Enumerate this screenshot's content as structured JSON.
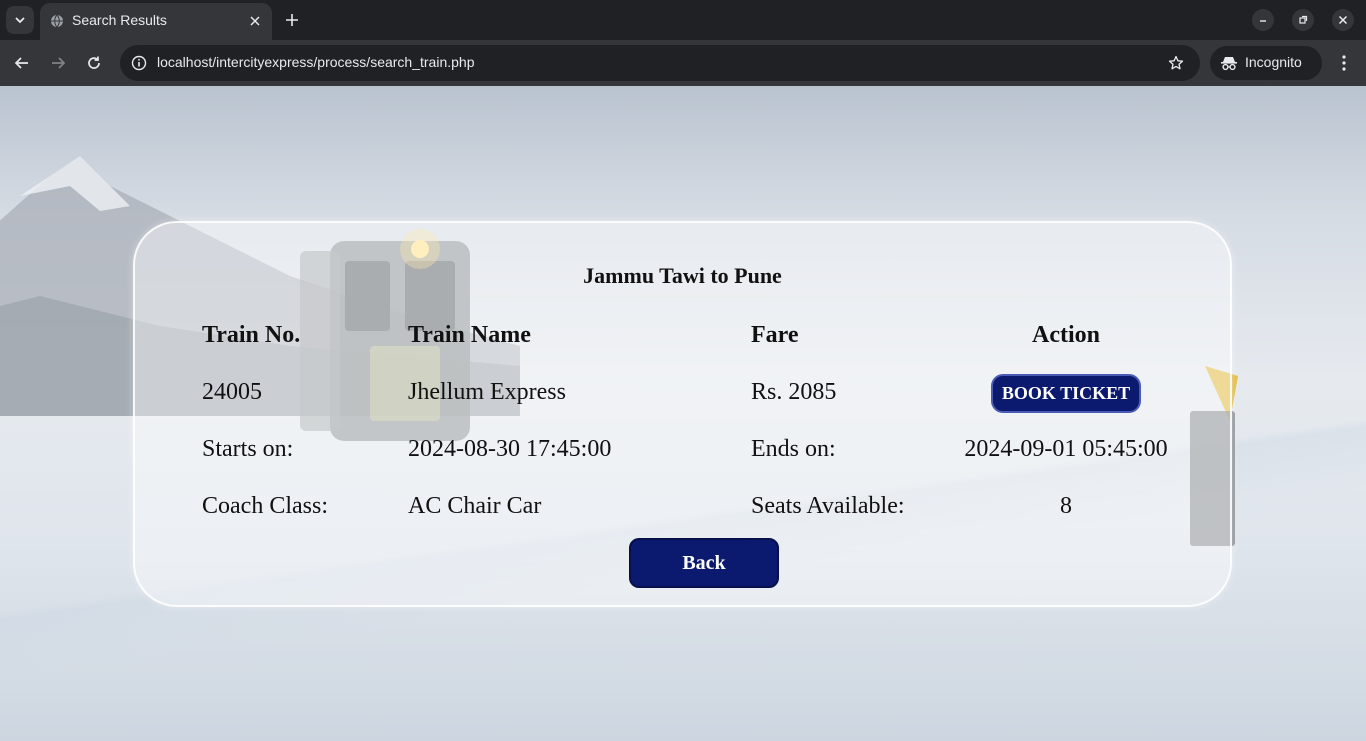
{
  "browser": {
    "tab_title": "Search Results",
    "url": "localhost/intercityexpress/process/search_train.php",
    "incognito_label": "Incognito"
  },
  "page": {
    "route_title": "Jammu Tawi to Pune",
    "headers": {
      "train_no": "Train No.",
      "train_name": "Train Name",
      "fare": "Fare",
      "action": "Action"
    },
    "train": {
      "number": "24005",
      "name": "Jhellum Express",
      "fare": "Rs. 2085",
      "book_label": "BOOK TICKET",
      "starts_label": "Starts on:",
      "starts_value": "2024-08-30 17:45:00",
      "ends_label": "Ends on:",
      "ends_value": "2024-09-01 05:45:00",
      "coach_label": "Coach Class:",
      "coach_value": "AC Chair Car",
      "seats_label": "Seats Available:",
      "seats_value": "8"
    },
    "back_label": "Back"
  },
  "colors": {
    "button_navy": "#0b1a6e",
    "chrome_dark": "#202124",
    "chrome_toolbar": "#35363a"
  }
}
